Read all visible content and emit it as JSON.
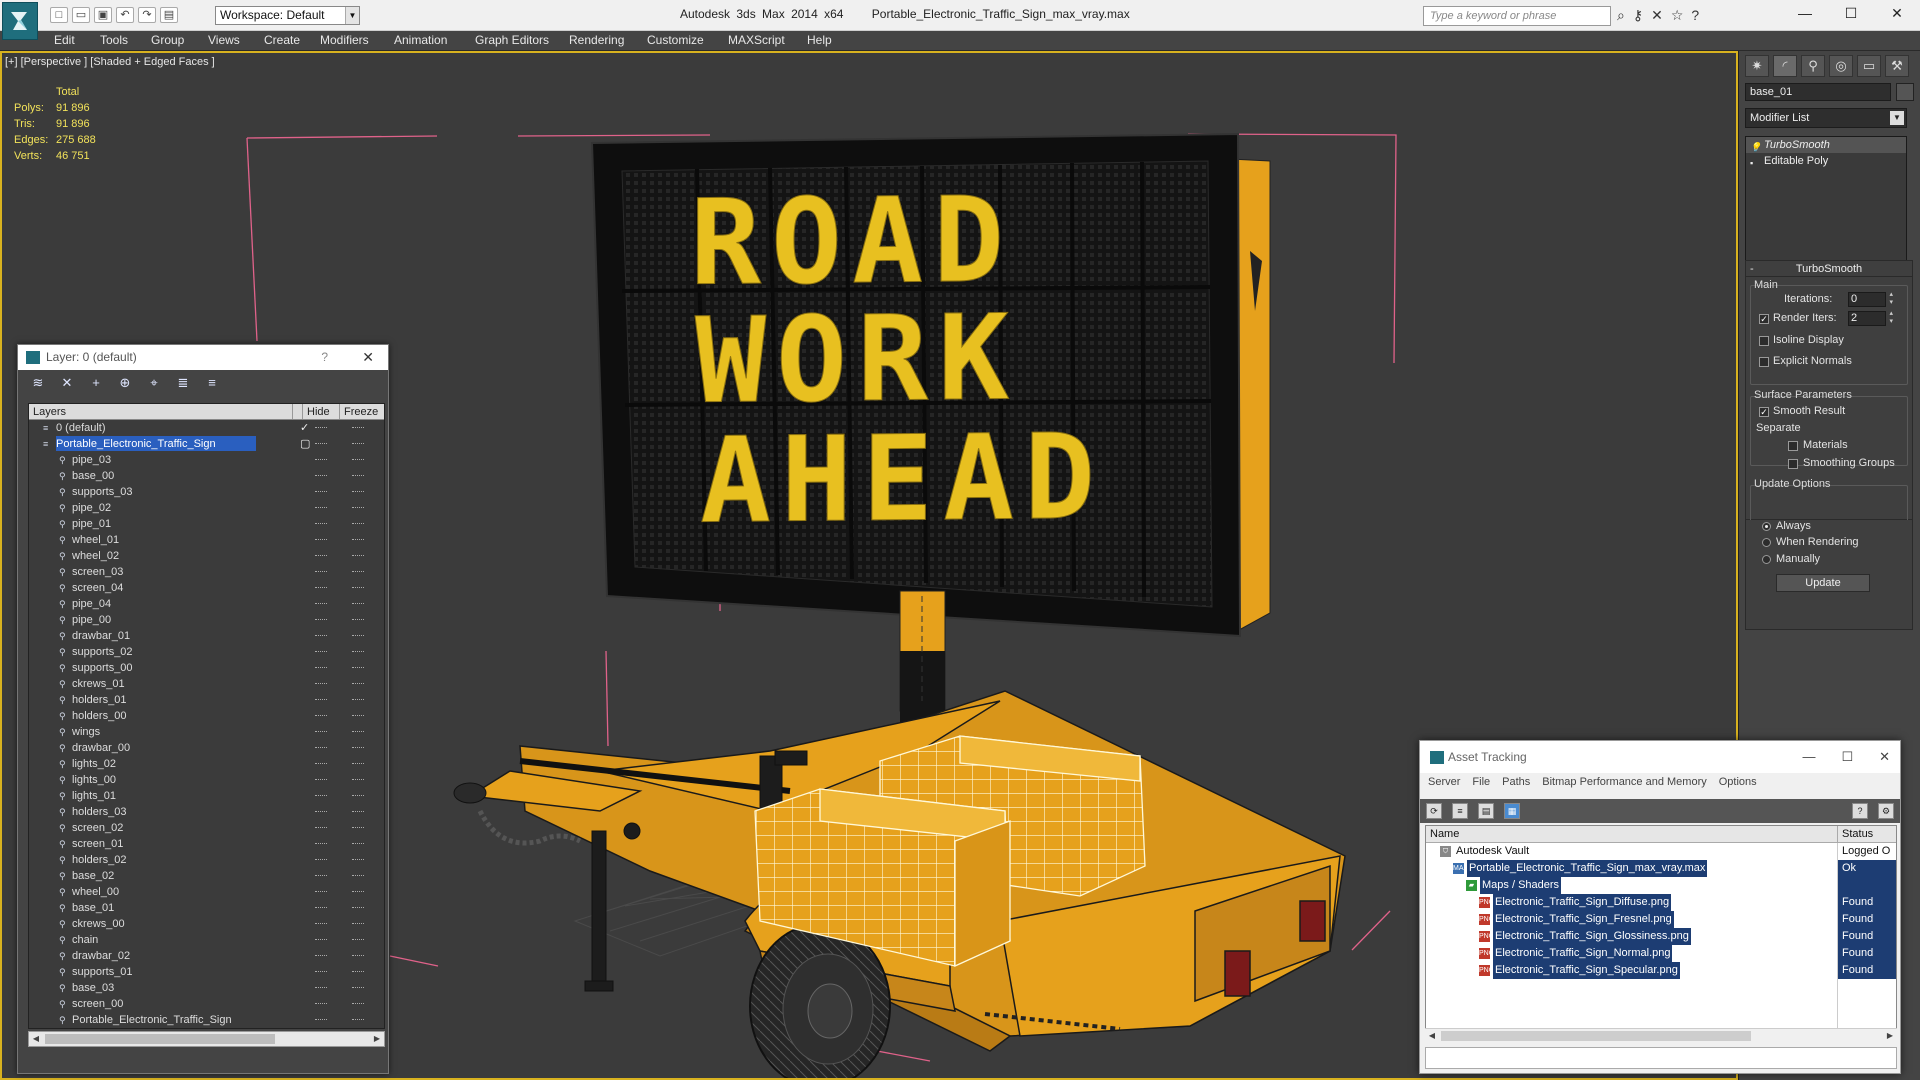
{
  "window": {
    "app": "Autodesk 3ds Max",
    "version": "2014 x64",
    "file": "Portable_Electronic_Traffic_Sign_max_vray.max",
    "workspace": "Workspace: Default",
    "search_placeholder": "Type a keyword or phrase"
  },
  "menu": [
    "Edit",
    "Tools",
    "Group",
    "Views",
    "Create",
    "Modifiers",
    "Animation",
    "Graph Editors",
    "Rendering",
    "Customize",
    "MAXScript",
    "Help"
  ],
  "viewport": {
    "label": "[+] [Perspective ] [Shaded + Edged Faces ]",
    "stats": {
      "header": "Total",
      "polys_label": "Polys:",
      "polys": "91 896",
      "tris_label": "Tris:",
      "tris": "91 896",
      "edges_label": "Edges:",
      "edges": "275 688",
      "verts_label": "Verts:",
      "verts": "46 751"
    },
    "sign_lines": [
      "ROAD",
      "WORK",
      "AHEAD"
    ]
  },
  "command_panel": {
    "object_name": "base_01",
    "modifier_list": "Modifier List",
    "stack": [
      "TurboSmooth",
      "Editable Poly"
    ],
    "rollout_title": "TurboSmooth",
    "main_label": "Main",
    "iterations_label": "Iterations:",
    "iterations": "0",
    "render_iters_label": "Render Iters:",
    "render_iters": "2",
    "isoline": "Isoline Display",
    "explicit_normals": "Explicit Normals",
    "surface_params": "Surface Parameters",
    "smooth_result": "Smooth Result",
    "separate": "Separate",
    "materials": "Materials",
    "smoothing_groups": "Smoothing Groups",
    "update_options": "Update Options",
    "always": "Always",
    "when_rendering": "When Rendering",
    "manually": "Manually",
    "update_button": "Update"
  },
  "layer_window": {
    "title": "Layer: 0 (default)",
    "help": "?",
    "columns": [
      "Layers",
      "Hide",
      "Freeze"
    ],
    "layers": [
      {
        "name": "0 (default)",
        "level": 0,
        "checked": true
      },
      {
        "name": "Portable_Electronic_Traffic_Sign",
        "level": 0,
        "selected": true
      },
      {
        "name": "pipe_03",
        "level": 1
      },
      {
        "name": "base_00",
        "level": 1
      },
      {
        "name": "supports_03",
        "level": 1
      },
      {
        "name": "pipe_02",
        "level": 1
      },
      {
        "name": "pipe_01",
        "level": 1
      },
      {
        "name": "wheel_01",
        "level": 1
      },
      {
        "name": "wheel_02",
        "level": 1
      },
      {
        "name": "screen_03",
        "level": 1
      },
      {
        "name": "screen_04",
        "level": 1
      },
      {
        "name": "pipe_04",
        "level": 1
      },
      {
        "name": "pipe_00",
        "level": 1
      },
      {
        "name": "drawbar_01",
        "level": 1
      },
      {
        "name": "supports_02",
        "level": 1
      },
      {
        "name": "supports_00",
        "level": 1
      },
      {
        "name": "ckrews_01",
        "level": 1
      },
      {
        "name": "holders_01",
        "level": 1
      },
      {
        "name": "holders_00",
        "level": 1
      },
      {
        "name": "wings",
        "level": 1
      },
      {
        "name": "drawbar_00",
        "level": 1
      },
      {
        "name": "lights_02",
        "level": 1
      },
      {
        "name": "lights_00",
        "level": 1
      },
      {
        "name": "lights_01",
        "level": 1
      },
      {
        "name": "holders_03",
        "level": 1
      },
      {
        "name": "screen_02",
        "level": 1
      },
      {
        "name": "screen_01",
        "level": 1
      },
      {
        "name": "holders_02",
        "level": 1
      },
      {
        "name": "base_02",
        "level": 1
      },
      {
        "name": "wheel_00",
        "level": 1
      },
      {
        "name": "base_01",
        "level": 1
      },
      {
        "name": "ckrews_00",
        "level": 1
      },
      {
        "name": "chain",
        "level": 1
      },
      {
        "name": "drawbar_02",
        "level": 1
      },
      {
        "name": "supports_01",
        "level": 1
      },
      {
        "name": "base_03",
        "level": 1
      },
      {
        "name": "screen_00",
        "level": 1
      },
      {
        "name": "Portable_Electronic_Traffic_Sign",
        "level": 1
      }
    ]
  },
  "asset_window": {
    "title": "Asset Tracking",
    "menu": [
      "Server",
      "File",
      "Paths",
      "Bitmap Performance and Memory",
      "Options"
    ],
    "columns": [
      "Name",
      "Status"
    ],
    "rows": [
      {
        "name": "Autodesk Vault",
        "status": "Logged O",
        "level": 0,
        "icon": "vault"
      },
      {
        "name": "Portable_Electronic_Traffic_Sign_max_vray.max",
        "status": "Ok",
        "level": 1,
        "icon": "max"
      },
      {
        "name": "Maps / Shaders",
        "status": "",
        "level": 2,
        "icon": "folder"
      },
      {
        "name": "Electronic_Traffic_Sign_Diffuse.png",
        "status": "Found",
        "level": 3,
        "icon": "png"
      },
      {
        "name": "Electronic_Traffic_Sign_Fresnel.png",
        "status": "Found",
        "level": 3,
        "icon": "png"
      },
      {
        "name": "Electronic_Traffic_Sign_Glossiness.png",
        "status": "Found",
        "level": 3,
        "icon": "png"
      },
      {
        "name": "Electronic_Traffic_Sign_Normal.png",
        "status": "Found",
        "level": 3,
        "icon": "png"
      },
      {
        "name": "Electronic_Traffic_Sign_Specular.png",
        "status": "Found",
        "level": 3,
        "icon": "png"
      }
    ]
  },
  "colors": {
    "viewport_bg": "#3b3b3b",
    "stats_yellow": "#f2e25a",
    "trailer_orange": "#e6a11c",
    "sign_led": "#e8c020",
    "selection_blue": "#2a5fbf",
    "bbox_pink": "#e0628a",
    "active_border": "#d8b21f"
  }
}
